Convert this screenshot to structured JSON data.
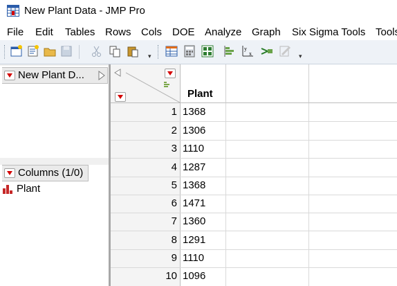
{
  "window": {
    "title": "New Plant Data - JMP Pro"
  },
  "menu": [
    "File",
    "Edit",
    "Tables",
    "Rows",
    "Cols",
    "DOE",
    "Analyze",
    "Graph",
    "Six Sigma Tools",
    "Tools"
  ],
  "toolbar": {
    "buttons": [
      "new-data-table-icon",
      "new-script-icon",
      "open-icon",
      "save-icon",
      "cut-icon",
      "copy-icon",
      "paste-icon",
      "data-table-icon",
      "calculator-icon",
      "journal-icon",
      "distribution-icon",
      "fit-y-by-x-icon",
      "fit-model-icon",
      "graph-builder-icon"
    ]
  },
  "table_panel": {
    "title": "New Plant D..."
  },
  "columns_panel": {
    "title": "Columns (1/0)",
    "items": [
      "Plant"
    ]
  },
  "grid": {
    "column_header": "Plant",
    "rows": [
      {
        "n": "1",
        "plant": "1368"
      },
      {
        "n": "2",
        "plant": "1306"
      },
      {
        "n": "3",
        "plant": "1110"
      },
      {
        "n": "4",
        "plant": "1287"
      },
      {
        "n": "5",
        "plant": "1368"
      },
      {
        "n": "6",
        "plant": "1471"
      },
      {
        "n": "7",
        "plant": "1360"
      },
      {
        "n": "8",
        "plant": "1291"
      },
      {
        "n": "9",
        "plant": "1110"
      },
      {
        "n": "10",
        "plant": "1096"
      }
    ]
  },
  "colors": {
    "accent_red": "#d40000",
    "toolbar_bg": "#eef2f7"
  }
}
